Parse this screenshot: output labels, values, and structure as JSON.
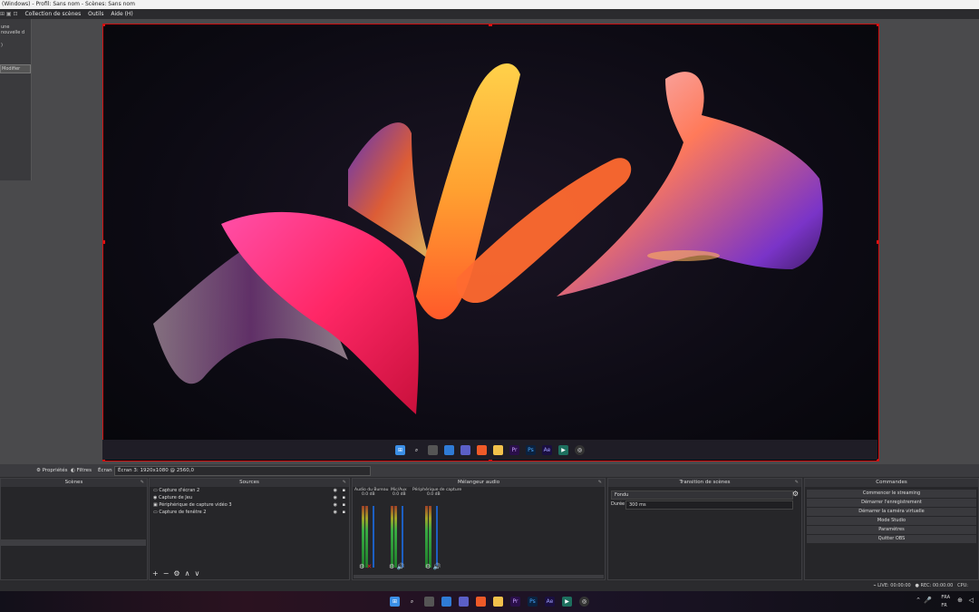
{
  "window": {
    "title": "(Windows) - Profil: Sans nom - Scènes: Sans nom"
  },
  "menu": {
    "items": [
      "Collection de scènes",
      "Outils",
      "Aide (H)"
    ]
  },
  "left_dock": {
    "line1": "une nouvelle d",
    "line2": ")",
    "button": "Modifier"
  },
  "source_bar": {
    "properties": "Propriétés",
    "filters": "Filtres",
    "screen_label": "Écran",
    "screen_value": "Écran 3: 1920x1080 @ 2560,0"
  },
  "scenes": {
    "title": "Scènes"
  },
  "sources": {
    "title": "Sources",
    "items": [
      "Capture d'écran 2",
      "Capture de Jeu",
      "Périphérique de capture vidéo 3",
      "Capture de fenêtre 2"
    ]
  },
  "mixer": {
    "title": "Mélangeur audio",
    "channels": [
      {
        "name": "Audio du Bureau",
        "db": "0.0 dB"
      },
      {
        "name": "Mic/Aux",
        "db": "0.0 dB"
      },
      {
        "name": "Périphérique de capture",
        "db": "0.0 dB"
      }
    ]
  },
  "transitions": {
    "title": "Transition de scènes",
    "type": "Fondu",
    "duration_label": "Durée",
    "duration_value": "300 ms"
  },
  "controls": {
    "title": "Commandes",
    "buttons": [
      "Commencer le streaming",
      "Démarrer l'enregistrement",
      "Démarrer la caméra virtuelle",
      "Mode Studio",
      "Paramètres",
      "Quitter OBS"
    ]
  },
  "status": {
    "live": "LIVE: 00:00:00",
    "rec": "REC: 00:00:00",
    "cpu": "CPU:"
  },
  "tray": {
    "lang1": "FRA",
    "lang2": "FR"
  },
  "taskbar_icons": [
    "windows-icon",
    "search-icon",
    "taskview-icon",
    "widgets-icon",
    "teams-icon",
    "brave-icon",
    "folder-icon",
    "premiere-icon",
    "photoshop-icon",
    "aftereffects-icon",
    "terminal-icon",
    "obs-icon"
  ]
}
